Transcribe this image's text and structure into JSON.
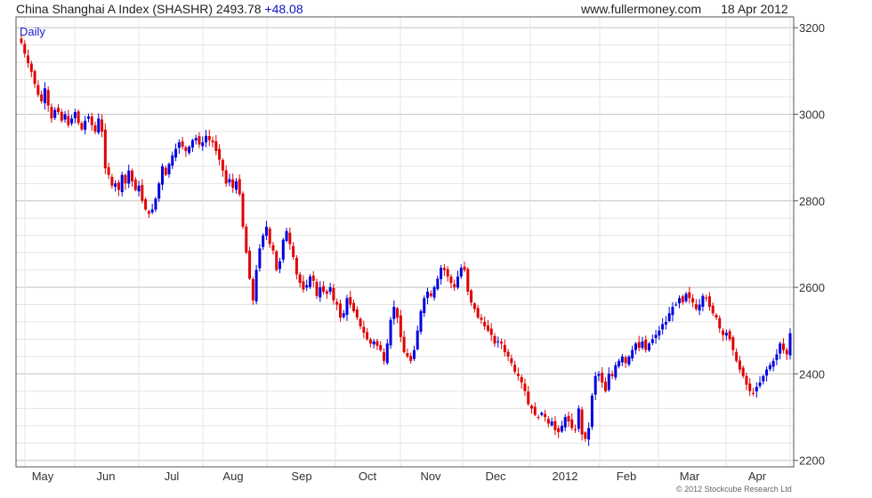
{
  "header": {
    "instrument": "China Shanghai A Index (SHASHR)",
    "price": "2493.78",
    "change": "+48.08",
    "site": "www.fullermoney.com",
    "date": "18 Apr 2012"
  },
  "period_label": "Daily",
  "copyright": "© 2012 Stockcube Research Ltd",
  "chart_data": {
    "type": "candlestick",
    "title": "China Shanghai A Index (SHASHR)",
    "x_tick_labels": [
      "May",
      "Jun",
      "Jul",
      "Aug",
      "Sep",
      "Oct",
      "Nov",
      "Dec",
      "2012",
      "Feb",
      "Mar",
      "Apr"
    ],
    "y_ticks": [
      2200,
      2400,
      2600,
      2800,
      3000,
      3200
    ],
    "ylim": [
      2185,
      3225
    ],
    "grid": true,
    "y_axis_side": "right",
    "colors": {
      "up": "#0000e0",
      "down": "#e00000",
      "grid": "#d8d8d8"
    },
    "closes_by_month": [
      {
        "month": "Apr-2011",
        "closes": [
          3165,
          3140,
          3118,
          3098,
          3070
        ]
      },
      {
        "month": "May",
        "closes": [
          3045,
          3030,
          3060,
          3020,
          2990,
          3010,
          3005,
          2985,
          3000,
          2975,
          2990,
          3005,
          2980,
          2965,
          2985,
          2995,
          2975,
          2960,
          2990,
          2960
        ]
      },
      {
        "month": "Jun",
        "closes": [
          2875,
          2860,
          2835,
          2840,
          2825,
          2860,
          2840,
          2870,
          2845,
          2825,
          2835,
          2800,
          2780,
          2770,
          2780,
          2805,
          2840,
          2880,
          2860,
          2885
        ]
      },
      {
        "month": "Jul",
        "closes": [
          2905,
          2920,
          2935,
          2925,
          2915,
          2925,
          2940,
          2945,
          2930,
          2935,
          2950,
          2940,
          2935,
          2915,
          2895,
          2870,
          2840,
          2850,
          2830,
          2845,
          2815
        ]
      },
      {
        "month": "Aug",
        "closes": [
          2740,
          2680,
          2620,
          2570,
          2640,
          2690,
          2720,
          2740,
          2700,
          2685,
          2640,
          2660,
          2710,
          2730,
          2700,
          2670,
          2630,
          2610,
          2595,
          2605,
          2625,
          2615,
          2580
        ]
      },
      {
        "month": "Sep",
        "closes": [
          2600,
          2590,
          2585,
          2600,
          2570,
          2560,
          2530,
          2540,
          2575,
          2560,
          2545,
          2530,
          2510,
          2495,
          2480,
          2470,
          2475,
          2465
        ]
      },
      {
        "month": "Oct",
        "closes": [
          2455,
          2430,
          2470,
          2525,
          2555,
          2530,
          2485,
          2450,
          2440,
          2430,
          2455,
          2500,
          2545,
          2575,
          2590,
          2580
        ]
      },
      {
        "month": "Nov",
        "closes": [
          2600,
          2620,
          2645,
          2640,
          2625,
          2610,
          2600,
          2625,
          2645,
          2640,
          2590,
          2565,
          2550,
          2530,
          2525,
          2510,
          2500,
          2490,
          2470,
          2475,
          2470,
          2450,
          2440
        ]
      },
      {
        "month": "Dec",
        "closes": [
          2425,
          2405,
          2395,
          2380,
          2360,
          2330,
          2320,
          2305,
          2300,
          2310,
          2300,
          2285,
          2290,
          2270,
          2265,
          2280,
          2300,
          2290,
          2275,
          2270,
          2320
        ]
      },
      {
        "month": "Jan-2012",
        "closes": [
          2260,
          2250,
          2275,
          2350,
          2395,
          2400,
          2380,
          2360,
          2400,
          2395,
          2420,
          2430,
          2440
        ]
      },
      {
        "month": "Feb",
        "closes": [
          2425,
          2440,
          2455,
          2470,
          2460,
          2475,
          2455,
          2470,
          2480,
          2490,
          2500,
          2515,
          2520,
          2540,
          2555,
          2560,
          2575,
          2565
        ]
      },
      {
        "month": "Mar",
        "closes": [
          2585,
          2575,
          2565,
          2550,
          2560,
          2580,
          2575,
          2555,
          2540,
          2530,
          2505,
          2490,
          2495,
          2480,
          2455,
          2430,
          2410,
          2395,
          2375,
          2360,
          2355
        ]
      },
      {
        "month": "Apr",
        "closes": [
          2370,
          2380,
          2395,
          2410,
          2420,
          2430,
          2445,
          2470,
          2455,
          2445,
          2494
        ]
      }
    ]
  }
}
